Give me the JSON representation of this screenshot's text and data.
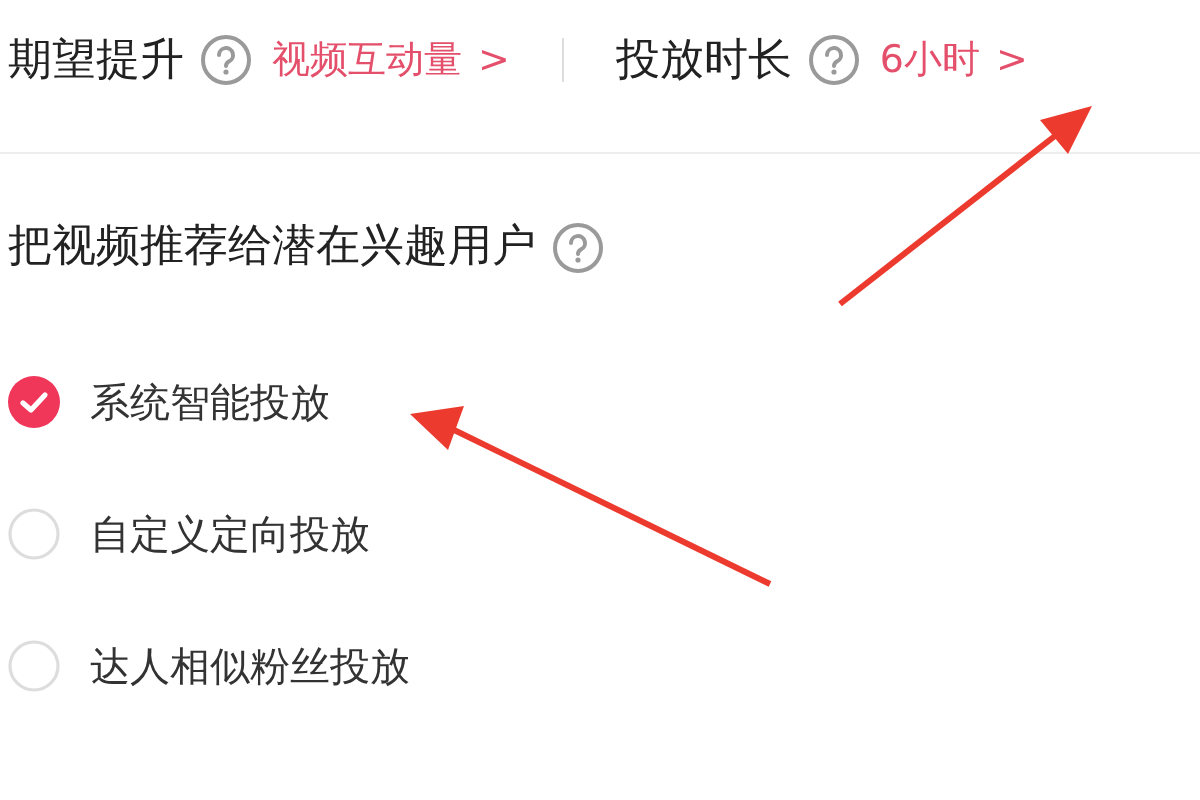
{
  "settings": [
    {
      "label": "期望提升",
      "value": "视频互动量",
      "chevron": ">"
    },
    {
      "label": "投放时长",
      "value": "6小时",
      "chevron": ">"
    }
  ],
  "section": {
    "title": "把视频推荐给潜在兴趣用户"
  },
  "options": [
    {
      "label": "系统智能投放",
      "selected": true
    },
    {
      "label": "自定义定向投放",
      "selected": false
    },
    {
      "label": "达人相似粉丝投放",
      "selected": false
    }
  ]
}
